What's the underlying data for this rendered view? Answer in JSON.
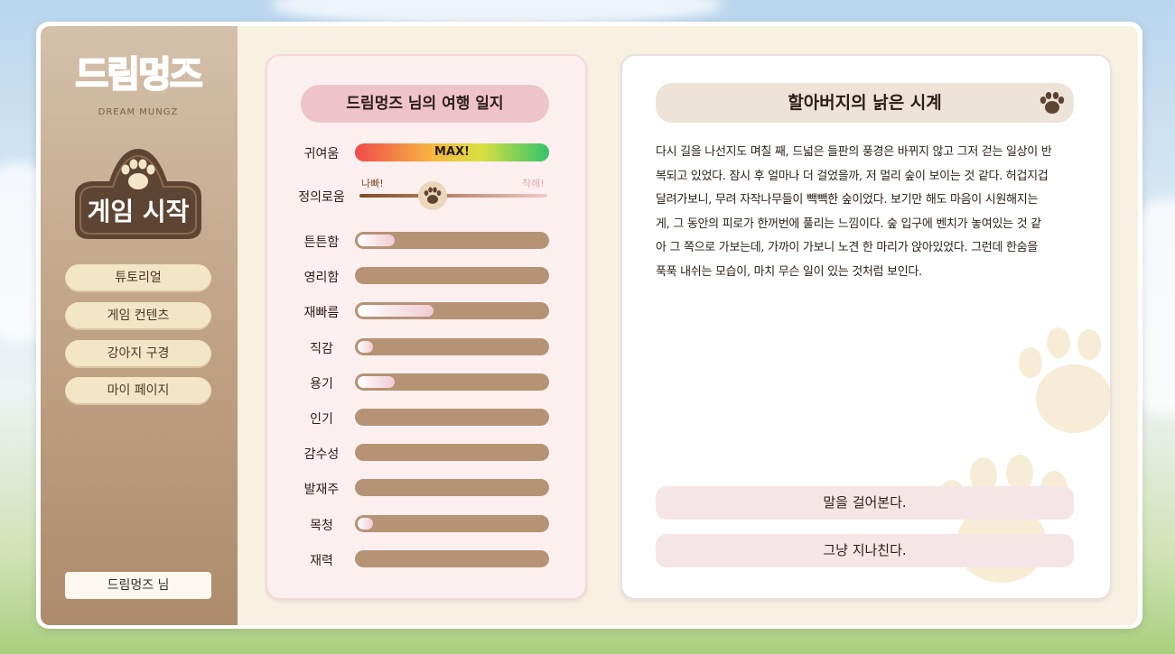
{
  "sidebar": {
    "logo_text": "드림멍즈",
    "logo_sub": "DREAM MUNGZ",
    "start_label": "게임 시작",
    "nav": [
      "튜토리얼",
      "게임 컨텐츠",
      "강아지 구경",
      "마이 페이지"
    ],
    "user": "드림멍즈 님"
  },
  "stats": {
    "title": "드림멍즈 님의 여행 일지",
    "cute": {
      "label": "귀여움",
      "value_text": "MAX!"
    },
    "alignment": {
      "label": "정의로움",
      "left": "나빠!",
      "right": "착해!",
      "value": 0.39
    },
    "items": [
      {
        "label": "튼튼함",
        "value": 0.19
      },
      {
        "label": "영리함",
        "value": 0.0
      },
      {
        "label": "재빠름",
        "value": 0.39
      },
      {
        "label": "직감",
        "value": 0.08
      },
      {
        "label": "용기",
        "value": 0.19
      },
      {
        "label": "인기",
        "value": 0.0
      },
      {
        "label": "감수성",
        "value": 0.0
      },
      {
        "label": "발재주",
        "value": 0.0
      },
      {
        "label": "목청",
        "value": 0.08
      },
      {
        "label": "재력",
        "value": 0.0
      }
    ]
  },
  "story": {
    "title": "할아버지의 낡은 시계",
    "lines": [
      "다시 길을 나선지도 며칠 째, 드넓은 들판의 풍경은 바뀌지 않고 그저 걷는 일상이 반",
      "복되고 있었다. 잠시 후 얼마나 더 걸었을까, 저 멀리 숲이 보이는 것 같다. 허겁지겁",
      "달려가보니, 무려 자작나무들이 빽빽한 숲이었다. 보기만 해도 마음이 시원해지는 ",
      "게, 그 동안의 피로가 한꺼번에 풀리는 느낌이다. 숲 입구에 벤치가 놓여있는 것 같",
      "아 그 쪽으로 가보는데, 가까이 가보니 노견 한 마리가 앉아있었다. 그런데 한숨을",
      "푹푹 내쉬는 모습이, 마치 무슨 일이 있는 것처럼 보인다."
    ],
    "choices": [
      "말을 걸어본다.",
      "그냥 지나친다."
    ]
  },
  "colors": {
    "sidebar": "#c3a68a",
    "nav_button": "#f3e5c7",
    "stat_track": "#b59374",
    "panel_pink": "#fcefef",
    "title_pink": "#efc4c7",
    "choice_pink": "#f6e5e6",
    "paw_brown": "#5e4433"
  }
}
